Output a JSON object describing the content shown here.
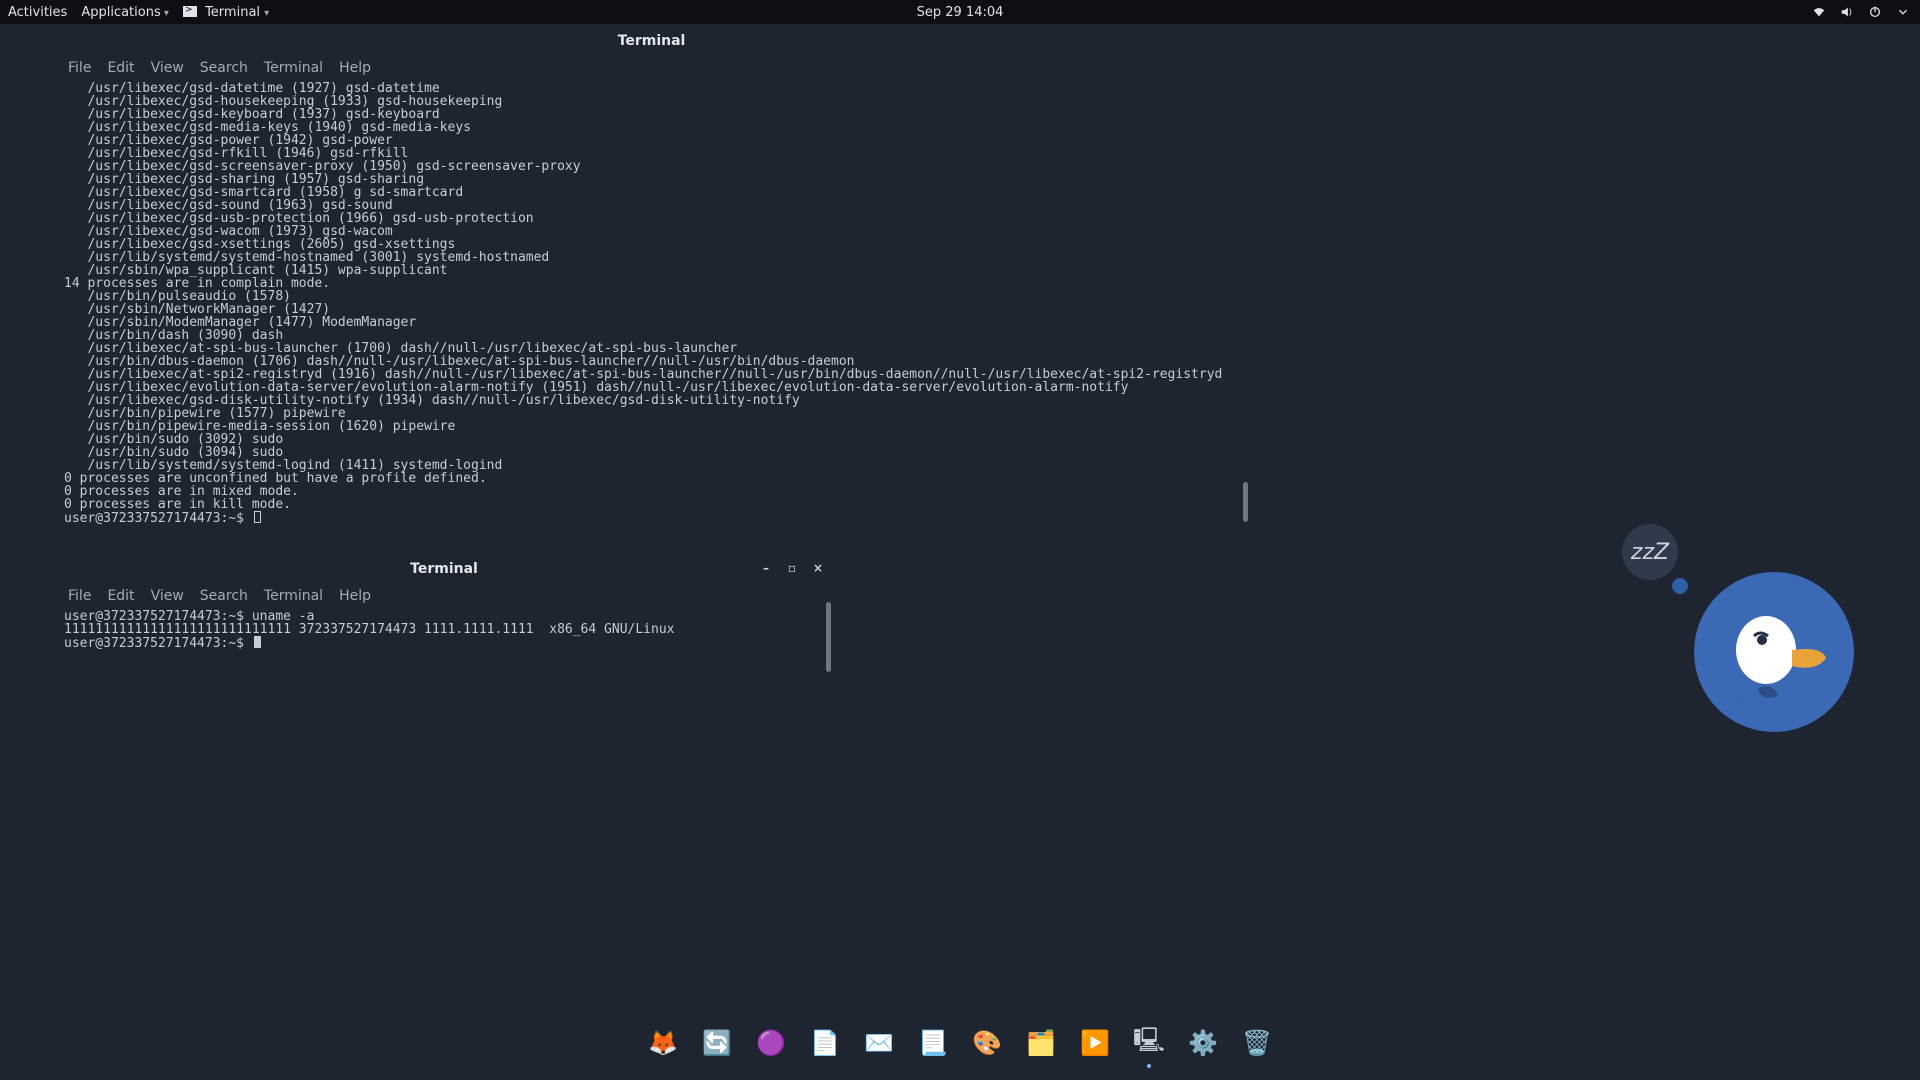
{
  "topbar": {
    "activities": "Activities",
    "applications": "Applications",
    "terminal_label": "Terminal",
    "clock": "Sep 29  14:04"
  },
  "term1": {
    "title": "Terminal",
    "menu": [
      "File",
      "Edit",
      "View",
      "Search",
      "Terminal",
      "Help"
    ],
    "lines": [
      "   /usr/libexec/gsd-datetime (1927) gsd-datetime",
      "   /usr/libexec/gsd-housekeeping (1933) gsd-housekeeping",
      "   /usr/libexec/gsd-keyboard (1937) gsd-keyboard",
      "   /usr/libexec/gsd-media-keys (1940) gsd-media-keys",
      "   /usr/libexec/gsd-power (1942) gsd-power",
      "   /usr/libexec/gsd-rfkill (1946) gsd-rfkill",
      "   /usr/libexec/gsd-screensaver-proxy (1950) gsd-screensaver-proxy",
      "   /usr/libexec/gsd-sharing (1957) gsd-sharing",
      "   /usr/libexec/gsd-smartcard (1958) g sd-smartcard",
      "   /usr/libexec/gsd-sound (1963) gsd-sound",
      "   /usr/libexec/gsd-usb-protection (1966) gsd-usb-protection",
      "   /usr/libexec/gsd-wacom (1973) gsd-wacom",
      "   /usr/libexec/gsd-xsettings (2605) gsd-xsettings",
      "   /usr/lib/systemd/systemd-hostnamed (3001) systemd-hostnamed",
      "   /usr/sbin/wpa_supplicant (1415) wpa-supplicant",
      "14 processes are in complain mode.",
      "   /usr/bin/pulseaudio (1578)",
      "   /usr/sbin/NetworkManager (1427)",
      "   /usr/sbin/ModemManager (1477) ModemManager",
      "   /usr/bin/dash (3090) dash",
      "   /usr/libexec/at-spi-bus-launcher (1700) dash//null-/usr/libexec/at-spi-bus-launcher",
      "   /usr/bin/dbus-daemon (1706) dash//null-/usr/libexec/at-spi-bus-launcher//null-/usr/bin/dbus-daemon",
      "   /usr/libexec/at-spi2-registryd (1916) dash//null-/usr/libexec/at-spi-bus-launcher//null-/usr/bin/dbus-daemon//null-/usr/libexec/at-spi2-registryd",
      "   /usr/libexec/evolution-data-server/evolution-alarm-notify (1951) dash//null-/usr/libexec/evolution-data-server/evolution-alarm-notify",
      "   /usr/libexec/gsd-disk-utility-notify (1934) dash//null-/usr/libexec/gsd-disk-utility-notify",
      "   /usr/bin/pipewire (1577) pipewire",
      "   /usr/bin/pipewire-media-session (1620) pipewire",
      "   /usr/bin/sudo (3092) sudo",
      "   /usr/bin/sudo (3094) sudo",
      "   /usr/lib/systemd/systemd-logind (1411) systemd-logind",
      "0 processes are unconfined but have a profile defined.",
      "0 processes are in mixed mode.",
      "0 processes are in kill mode."
    ],
    "prompt": "user@372337527174473:~$ "
  },
  "term2": {
    "title": "Terminal",
    "menu": [
      "File",
      "Edit",
      "View",
      "Search",
      "Terminal",
      "Help"
    ],
    "lines": [
      "user@372337527174473:~$ uname -a",
      "11111111111111111111111111111 372337527174473 1111.1111.1111  x86_64 GNU/Linux"
    ],
    "prompt": "user@372337527174473:~$ "
  },
  "dock": {
    "apps": [
      {
        "name": "firefox",
        "glyph": "🦊"
      },
      {
        "name": "sync",
        "glyph": "🔄"
      },
      {
        "name": "podcasts",
        "glyph": "🟣"
      },
      {
        "name": "gedit",
        "glyph": "📄"
      },
      {
        "name": "mail",
        "glyph": "✉️"
      },
      {
        "name": "document",
        "glyph": "📃"
      },
      {
        "name": "drawing",
        "glyph": "🎨"
      },
      {
        "name": "files",
        "glyph": "🗂️"
      },
      {
        "name": "media",
        "glyph": "▶️"
      },
      {
        "name": "terminal",
        "glyph": "🖳"
      },
      {
        "name": "settings",
        "glyph": "⚙️"
      },
      {
        "name": "trash",
        "glyph": "🗑️"
      }
    ]
  },
  "widget": {
    "zz": "zzZ"
  }
}
